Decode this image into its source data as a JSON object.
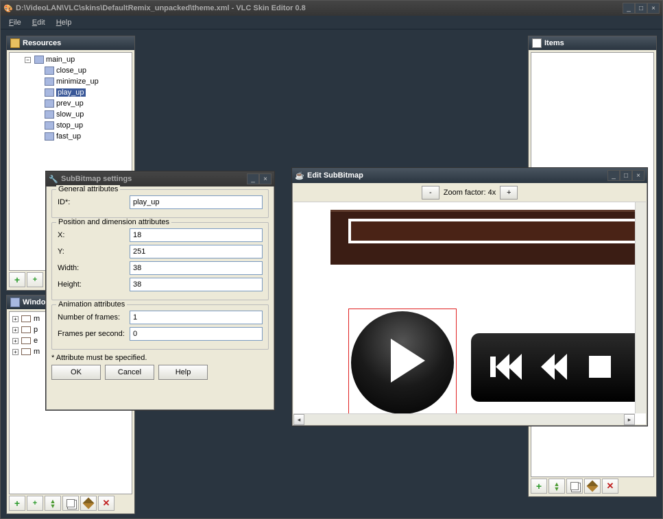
{
  "main_window": {
    "title": "D:\\VideoLAN\\VLC\\skins\\DefaultRemix_unpacked\\theme.xml - VLC Skin Editor 0.8"
  },
  "menu": {
    "file": "File",
    "edit": "Edit",
    "help": "Help"
  },
  "resources": {
    "title": "Resources",
    "tree": {
      "root": "main_up",
      "items": [
        "close_up",
        "minimize_up",
        "play_up",
        "prev_up",
        "slow_up",
        "stop_up",
        "fast_up"
      ],
      "selected": "play_up"
    }
  },
  "windows_panel": {
    "title": "Windows",
    "items": [
      "m",
      "p",
      "e",
      "m"
    ]
  },
  "items_panel": {
    "title": "Items"
  },
  "settings_dialog": {
    "title": "SubBitmap settings",
    "groups": {
      "general": "General attributes",
      "posdim": "Position and dimension attributes",
      "anim": "Animation attributes"
    },
    "labels": {
      "id": "ID*:",
      "x": "X:",
      "y": "Y:",
      "width": "Width:",
      "height": "Height:",
      "nof": "Number of frames:",
      "fps": "Frames per second:"
    },
    "values": {
      "id": "play_up",
      "x": "18",
      "y": "251",
      "width": "38",
      "height": "38",
      "nof": "1",
      "fps": "0"
    },
    "footnote": "* Attribute must be specified.",
    "buttons": {
      "ok": "OK",
      "cancel": "Cancel",
      "help": "Help"
    }
  },
  "edit_window": {
    "title": "Edit SubBitmap",
    "zoom_label": "Zoom factor: 4x",
    "zoom_minus": "-",
    "zoom_plus": "+"
  }
}
